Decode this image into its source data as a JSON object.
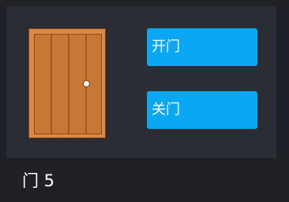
{
  "door_card": {
    "open_label": "开门",
    "close_label": "关门"
  },
  "footer": {
    "door_name": "门 5"
  },
  "colors": {
    "background": "#1f2127",
    "card": "#2a2d33",
    "button": "#0aa8f4",
    "door": "#d98a47"
  },
  "icons": {
    "door": "door-icon"
  }
}
